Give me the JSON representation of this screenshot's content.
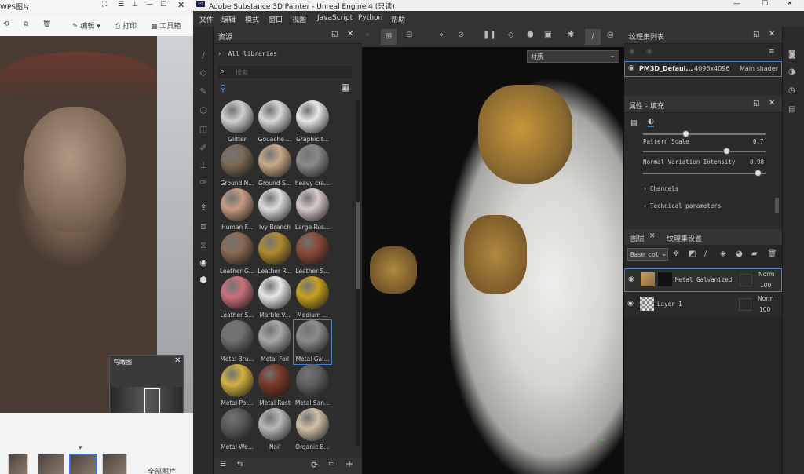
{
  "wps": {
    "title": "WPS图片",
    "toolbar": {
      "edit": "编辑",
      "print": "打印",
      "tools": "工具箱"
    },
    "bird_view": "鸟瞰图",
    "all_images": "全部图片"
  },
  "painter": {
    "title": "Adobe Substance 3D Painter - Unreal Engine 4 (只读)",
    "menu": [
      "文件",
      "编辑",
      "模式",
      "窗口",
      "视图",
      "JavaScript",
      "Python",
      "帮助"
    ],
    "assets": {
      "title": "资源",
      "library": "All libraries",
      "search_placeholder": "搜索",
      "materials": [
        {
          "name": "Glitter",
          "color": "#cfcfcf"
        },
        {
          "name": "Gouache ...",
          "color": "#d8d8d8"
        },
        {
          "name": "Graphic t...",
          "color": "#e8e8e8"
        },
        {
          "name": "Ground N...",
          "color": "#7a6a58"
        },
        {
          "name": "Ground S...",
          "color": "#c7aa88"
        },
        {
          "name": "heavy cra...",
          "color": "#8a8a8a"
        },
        {
          "name": "Human F...",
          "color": "#c79a82"
        },
        {
          "name": "Ivy Branch",
          "color": "#dcdcdc"
        },
        {
          "name": "Large Rus...",
          "color": "#d8c8c8"
        },
        {
          "name": "Leather G...",
          "color": "#8a6a55"
        },
        {
          "name": "Leather R...",
          "color": "#b08a30"
        },
        {
          "name": "Leather S...",
          "color": "#8a4a38"
        },
        {
          "name": "Leather S...",
          "color": "#c8727a"
        },
        {
          "name": "Marble V...",
          "color": "#e8e8e8"
        },
        {
          "name": "Medium ...",
          "color": "#c8a020"
        },
        {
          "name": "Metal Bru...",
          "color": "#707070"
        },
        {
          "name": "Metal Foil",
          "color": "#a8a8a8"
        },
        {
          "name": "Metal Gal...",
          "color": "#8c8c8c"
        },
        {
          "name": "Metal Pol...",
          "color": "#d0b040"
        },
        {
          "name": "Metal Rust",
          "color": "#7a3828"
        },
        {
          "name": "Metal San...",
          "color": "#606060"
        },
        {
          "name": "Metal We...",
          "color": "#5a5a5a"
        },
        {
          "name": "Nail",
          "color": "#b8b8b8"
        },
        {
          "name": "Organic B...",
          "color": "#d0c0a8"
        }
      ]
    },
    "viewport": {
      "material_select": "材质"
    },
    "texture_sets": {
      "title": "纹理集列表",
      "name": "PM3D_Defaul...",
      "resolution": "4096x4096",
      "shader": "Main shader"
    },
    "properties": {
      "title": "属性 - 填充",
      "pattern_scale_label": "Pattern Scale",
      "pattern_scale_value": "0.7",
      "normal_label": "Normal Variation Intensity",
      "normal_value": "0.98",
      "channels": "Channels",
      "technical": "Technical parameters"
    },
    "layers": {
      "tab_layers": "图层",
      "tab_settings": "纹理集设置",
      "channel_select": "Base col",
      "items": [
        {
          "name": "Metal Galvanized",
          "blend": "Norm",
          "opacity": "100"
        },
        {
          "name": "Layer 1",
          "blend": "Norm",
          "opacity": "100"
        }
      ]
    }
  }
}
